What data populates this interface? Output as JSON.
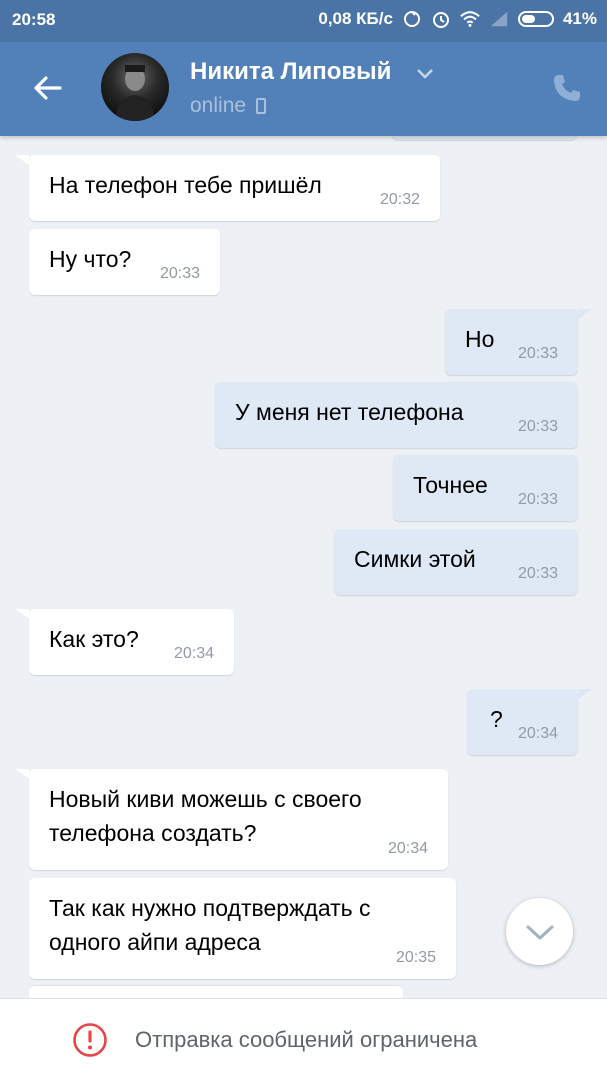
{
  "status_bar": {
    "time": "20:58",
    "network_speed": "0,08 КБ/с",
    "battery_percent": "41%",
    "icons": [
      "sync-icon",
      "alarm-icon",
      "wifi-icon",
      "signal-icon",
      "battery-icon"
    ]
  },
  "header": {
    "contact_name": "Никита Липовый",
    "presence": "online",
    "back_icon": "arrow-left-icon",
    "call_icon": "phone-icon",
    "accent": "#5181b8"
  },
  "messages": [
    {
      "dir": "in",
      "text": "На телефон тебе пришёл",
      "time": "20:32"
    },
    {
      "dir": "in",
      "text": "Ну что?",
      "time": "20:33"
    },
    {
      "dir": "out",
      "text": "Но",
      "time": "20:33"
    },
    {
      "dir": "out",
      "text": "У меня нет телефона",
      "time": "20:33"
    },
    {
      "dir": "out",
      "text": "Точнее",
      "time": "20:33"
    },
    {
      "dir": "out",
      "text": "Симки этой",
      "time": "20:33"
    },
    {
      "dir": "in",
      "text": "Как это?",
      "time": "20:34"
    },
    {
      "dir": "out",
      "text": "?",
      "time": "20:34"
    },
    {
      "dir": "in",
      "text": "Новый киви можешь с своего телефона создать?",
      "time": "20:34"
    },
    {
      "dir": "in",
      "text": "Так как нужно подтверждать с одного айпи адреса",
      "time": "20:35"
    }
  ],
  "footer": {
    "notice": "Отправка сообщений ограничена",
    "notice_icon": "warning-circle-icon",
    "notice_color": "#e64646"
  }
}
